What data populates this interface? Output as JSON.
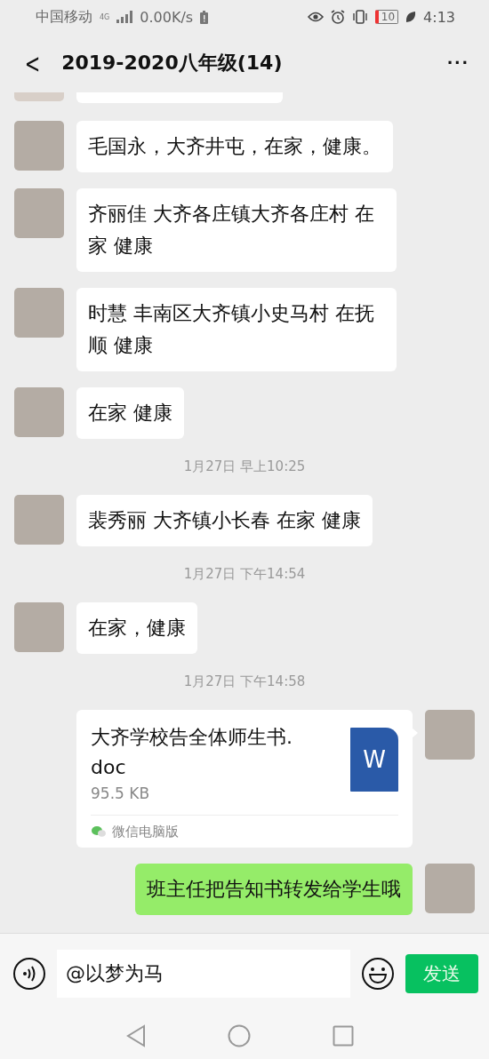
{
  "status_bar": {
    "carrier": "中国移动",
    "network": "4G",
    "speed": "0.00K/s",
    "battery": "10",
    "time": "4:13"
  },
  "header": {
    "back": "<",
    "title": "2019-2020八年级(14)",
    "more": "···"
  },
  "messages": [
    {
      "kind": "clipped",
      "sent": false
    },
    {
      "kind": "text",
      "sent": false,
      "text": "毛国永，大齐井屯，在家，健康。"
    },
    {
      "kind": "text",
      "sent": false,
      "text": "齐丽佳  大齐各庄镇大齐各庄村  在家  健康"
    },
    {
      "kind": "text",
      "sent": false,
      "text": "时慧 丰南区大齐镇小史马村 在抚顺 健康"
    },
    {
      "kind": "text",
      "sent": false,
      "text": "在家 健康"
    },
    {
      "kind": "time",
      "text": "1月27日 早上10:25"
    },
    {
      "kind": "text",
      "sent": false,
      "text": "裴秀丽  大齐镇小长春 在家  健康"
    },
    {
      "kind": "time",
      "text": "1月27日 下午14:54"
    },
    {
      "kind": "text",
      "sent": false,
      "text": "在家，健康"
    },
    {
      "kind": "time",
      "text": "1月27日 下午14:58"
    },
    {
      "kind": "file",
      "sent": true,
      "name": "大齐学校告全体师生书.doc",
      "size": "95.5 KB",
      "file_icon": "W",
      "source": "微信电脑版"
    },
    {
      "kind": "text",
      "sent": true,
      "text": "班主任把告知书转发给学生哦"
    }
  ],
  "input_bar": {
    "value": "@以梦为马",
    "send": "发送"
  }
}
